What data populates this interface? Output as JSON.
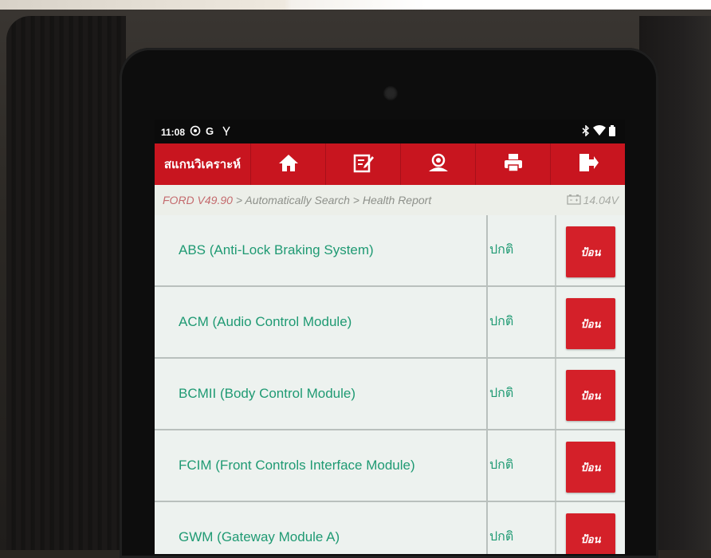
{
  "statusbar": {
    "time": "11:08",
    "left_icons": [
      "settings-icon",
      "google-icon",
      "usb-debug-icon"
    ],
    "right_icons": [
      "bluetooth-icon",
      "wifi-icon",
      "battery-icon"
    ]
  },
  "toolbar": {
    "title": "สแกนวิเคราะห์",
    "buttons": [
      {
        "name": "home",
        "icon": "home-icon"
      },
      {
        "name": "report",
        "icon": "edit-icon"
      },
      {
        "name": "remote-support",
        "icon": "support-icon"
      },
      {
        "name": "print",
        "icon": "printer-icon"
      },
      {
        "name": "exit",
        "icon": "exit-icon"
      }
    ],
    "bar_color": "#c8151f"
  },
  "breadcrumb": {
    "first": "FORD V49.90",
    "rest": " > Automatically Search > Health Report",
    "voltage": "14.04V"
  },
  "modules": [
    {
      "name": "ABS (Anti-Lock Braking System)",
      "status": "ปกติ",
      "action": "ป้อน"
    },
    {
      "name": "ACM (Audio Control Module)",
      "status": "ปกติ",
      "action": "ป้อน"
    },
    {
      "name": "BCMII (Body Control Module)",
      "status": "ปกติ",
      "action": "ป้อน"
    },
    {
      "name": "FCIM (Front Controls Interface Module)",
      "status": "ปกติ",
      "action": "ป้อน"
    },
    {
      "name": "GWM (Gateway Module A)",
      "status": "ปกติ",
      "action": "ป้อน"
    }
  ],
  "colors": {
    "accent_red": "#d42029",
    "module_text": "#1f9a73",
    "list_bg": "#edf2ef"
  }
}
